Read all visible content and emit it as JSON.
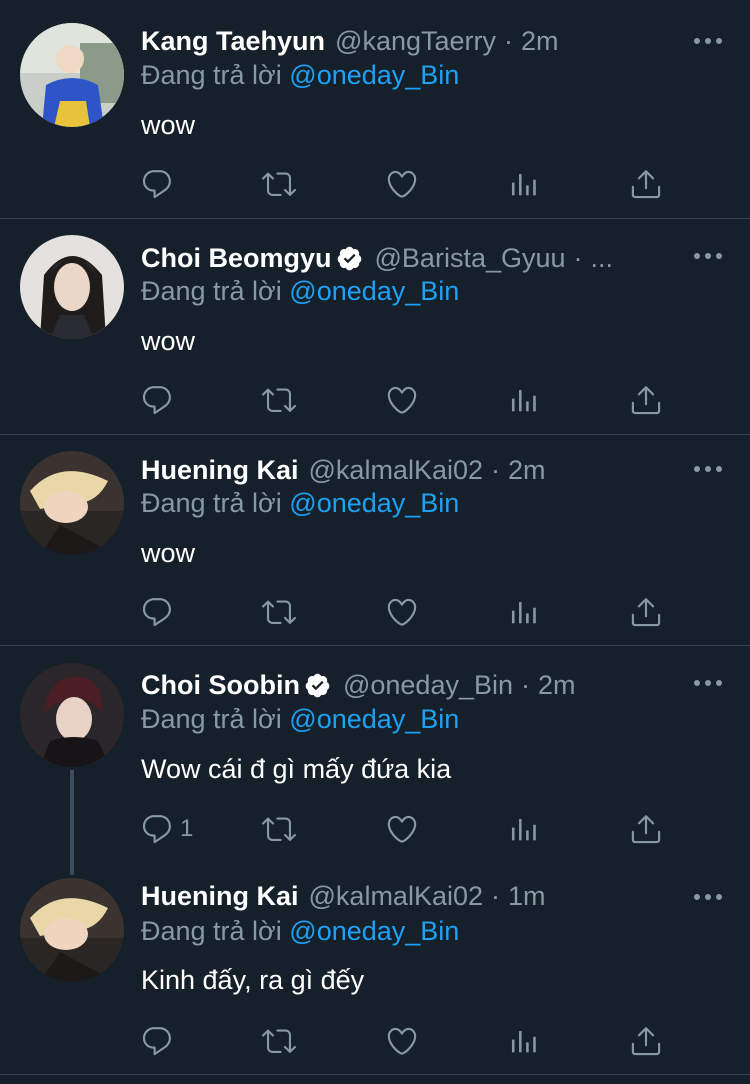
{
  "reply_prefix": "Đang trả lời",
  "colors": {
    "background": "#15202b",
    "text": "#ffffff",
    "muted": "#8899a6",
    "accent": "#1da1f2",
    "divider": "#38444d"
  },
  "tweets": [
    {
      "name": "Kang Taehyun",
      "verified": false,
      "handle": "@kangTaerry",
      "dot": "·",
      "time": "2m",
      "reply_to": "@oneday_Bin",
      "text": "wow",
      "reply_count": ""
    },
    {
      "name": "Choi Beomgyu",
      "verified": true,
      "handle": "@Barista_Gyuu",
      "dot": "·",
      "time": "...",
      "reply_to": "@oneday_Bin",
      "text": "wow",
      "reply_count": ""
    },
    {
      "name": "Huening Kai",
      "verified": false,
      "handle": "@kalmalKai02",
      "dot": "·",
      "time": "2m",
      "reply_to": "@oneday_Bin",
      "text": "wow",
      "reply_count": ""
    },
    {
      "name": "Choi Soobin",
      "verified": true,
      "handle": "@oneday_Bin",
      "dot": "·",
      "time": "2m",
      "reply_to": "@oneday_Bin",
      "text": "Wow cái đ gì mấy đứa kia",
      "reply_count": "1"
    },
    {
      "name": "Huening Kai",
      "verified": false,
      "handle": "@kalmalKai02",
      "dot": "·",
      "time": "1m",
      "reply_to": "@oneday_Bin",
      "text": "Kinh đấy, ra gì đếy",
      "reply_count": ""
    }
  ],
  "icons": [
    "reply-icon",
    "retweet-icon",
    "like-icon",
    "analytics-icon",
    "share-icon",
    "more-icon",
    "verified-badge-icon"
  ]
}
